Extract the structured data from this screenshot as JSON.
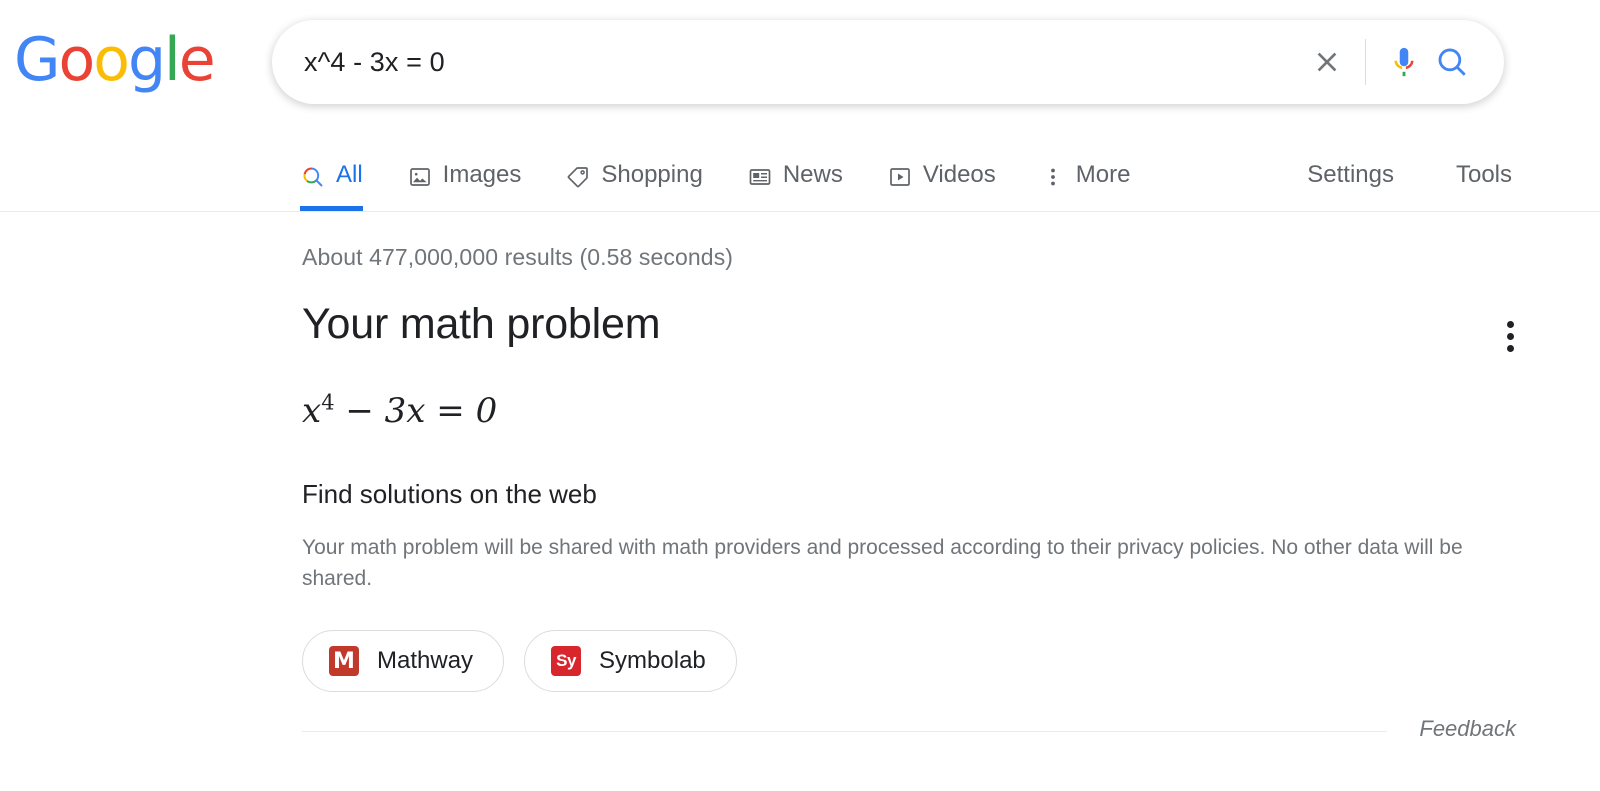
{
  "brand": {
    "name": "Google",
    "letters": [
      {
        "ch": "G",
        "color": "#4285F4"
      },
      {
        "ch": "o",
        "color": "#EA4335"
      },
      {
        "ch": "o",
        "color": "#FBBC05"
      },
      {
        "ch": "g",
        "color": "#4285F4"
      },
      {
        "ch": "l",
        "color": "#34A853"
      },
      {
        "ch": "e",
        "color": "#EA4335"
      }
    ]
  },
  "search": {
    "value": "x^4 - 3x = 0",
    "placeholder": "Search",
    "clear_icon": "close-icon",
    "voice_icon": "microphone-icon",
    "submit_icon": "search-icon"
  },
  "nav": {
    "tabs": [
      {
        "label": "All",
        "icon": "search-icon",
        "active": true
      },
      {
        "label": "Images",
        "icon": "image-icon",
        "active": false
      },
      {
        "label": "Shopping",
        "icon": "tag-icon",
        "active": false
      },
      {
        "label": "News",
        "icon": "newspaper-icon",
        "active": false
      },
      {
        "label": "Videos",
        "icon": "play-box-icon",
        "active": false
      },
      {
        "label": "More",
        "icon": "more-vertical-icon",
        "active": false
      }
    ],
    "settings_label": "Settings",
    "tools_label": "Tools"
  },
  "results": {
    "count_text": "About 477,000,000 results (0.58 seconds)"
  },
  "math_card": {
    "title": "Your math problem",
    "equation": {
      "base": "x",
      "exponent": "4",
      "rest": "− 3x = 0",
      "plain": "x^4 − 3x = 0"
    },
    "subheading": "Find solutions on the web",
    "disclaimer": "Your math problem will be shared with math providers and processed according to their privacy policies. No other data will be shared.",
    "menu_icon": "more-vertical-icon",
    "providers": [
      {
        "label": "Mathway",
        "logo_text": "M",
        "logo_color": "#c0392b"
      },
      {
        "label": "Symbolab",
        "logo_text": "Sy",
        "logo_color": "#d8262d"
      }
    ]
  },
  "footer": {
    "feedback_label": "Feedback"
  },
  "theme": {
    "accent": "#1a73e8",
    "text": "#202124",
    "muted": "#70757a",
    "border": "#dadce0"
  }
}
